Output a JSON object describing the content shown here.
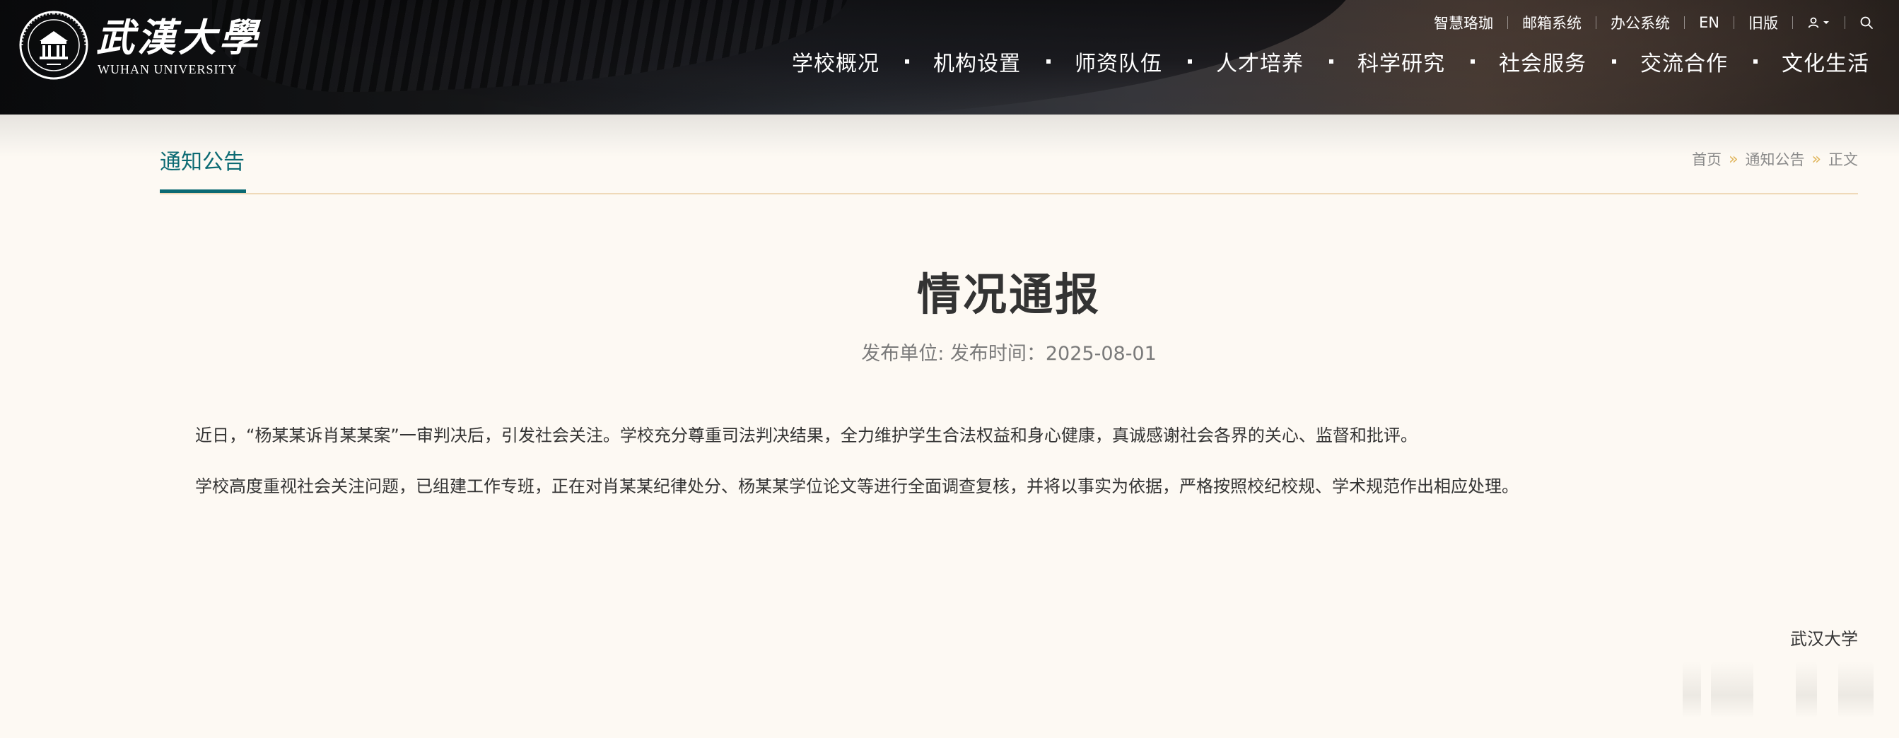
{
  "header": {
    "brand_cn": "武漢大學",
    "brand_en": "WUHAN UNIVERSITY",
    "utility": [
      "智慧珞珈",
      "邮箱系统",
      "办公系统",
      "EN",
      "旧版"
    ],
    "nav": [
      "学校概况",
      "机构设置",
      "师资队伍",
      "人才培养",
      "科学研究",
      "社会服务",
      "交流合作",
      "文化生活"
    ]
  },
  "section": {
    "title": "通知公告",
    "breadcrumb": {
      "home": "首页",
      "category": "通知公告",
      "current": "正文",
      "separator": "»"
    }
  },
  "article": {
    "title": "情况通报",
    "meta": "发布单位:  发布时间：2025-08-01",
    "paragraphs": [
      "近日，“杨某某诉肖某某案”一审判决后，引发社会关注。学校充分尊重司法判决结果，全力维护学生合法权益和身心健康，真诚感谢社会各界的关心、监督和批评。",
      "学校高度重视社会关注问题，已组建工作专班，正在对肖某某纪律处分、杨某某学位论文等进行全面调查复核，并将以事实为依据，严格按照校纪校规、学术规范作出相应处理。"
    ],
    "signature": "武汉大学"
  },
  "icons": {
    "user": "user-icon",
    "search": "search-icon",
    "seal": "university-seal-icon"
  },
  "colors": {
    "accent": "#0b6a73",
    "breadcrumb_separator": "#e0b45a",
    "divider": "#efd9b8",
    "page_background": "#fdf9f3"
  }
}
